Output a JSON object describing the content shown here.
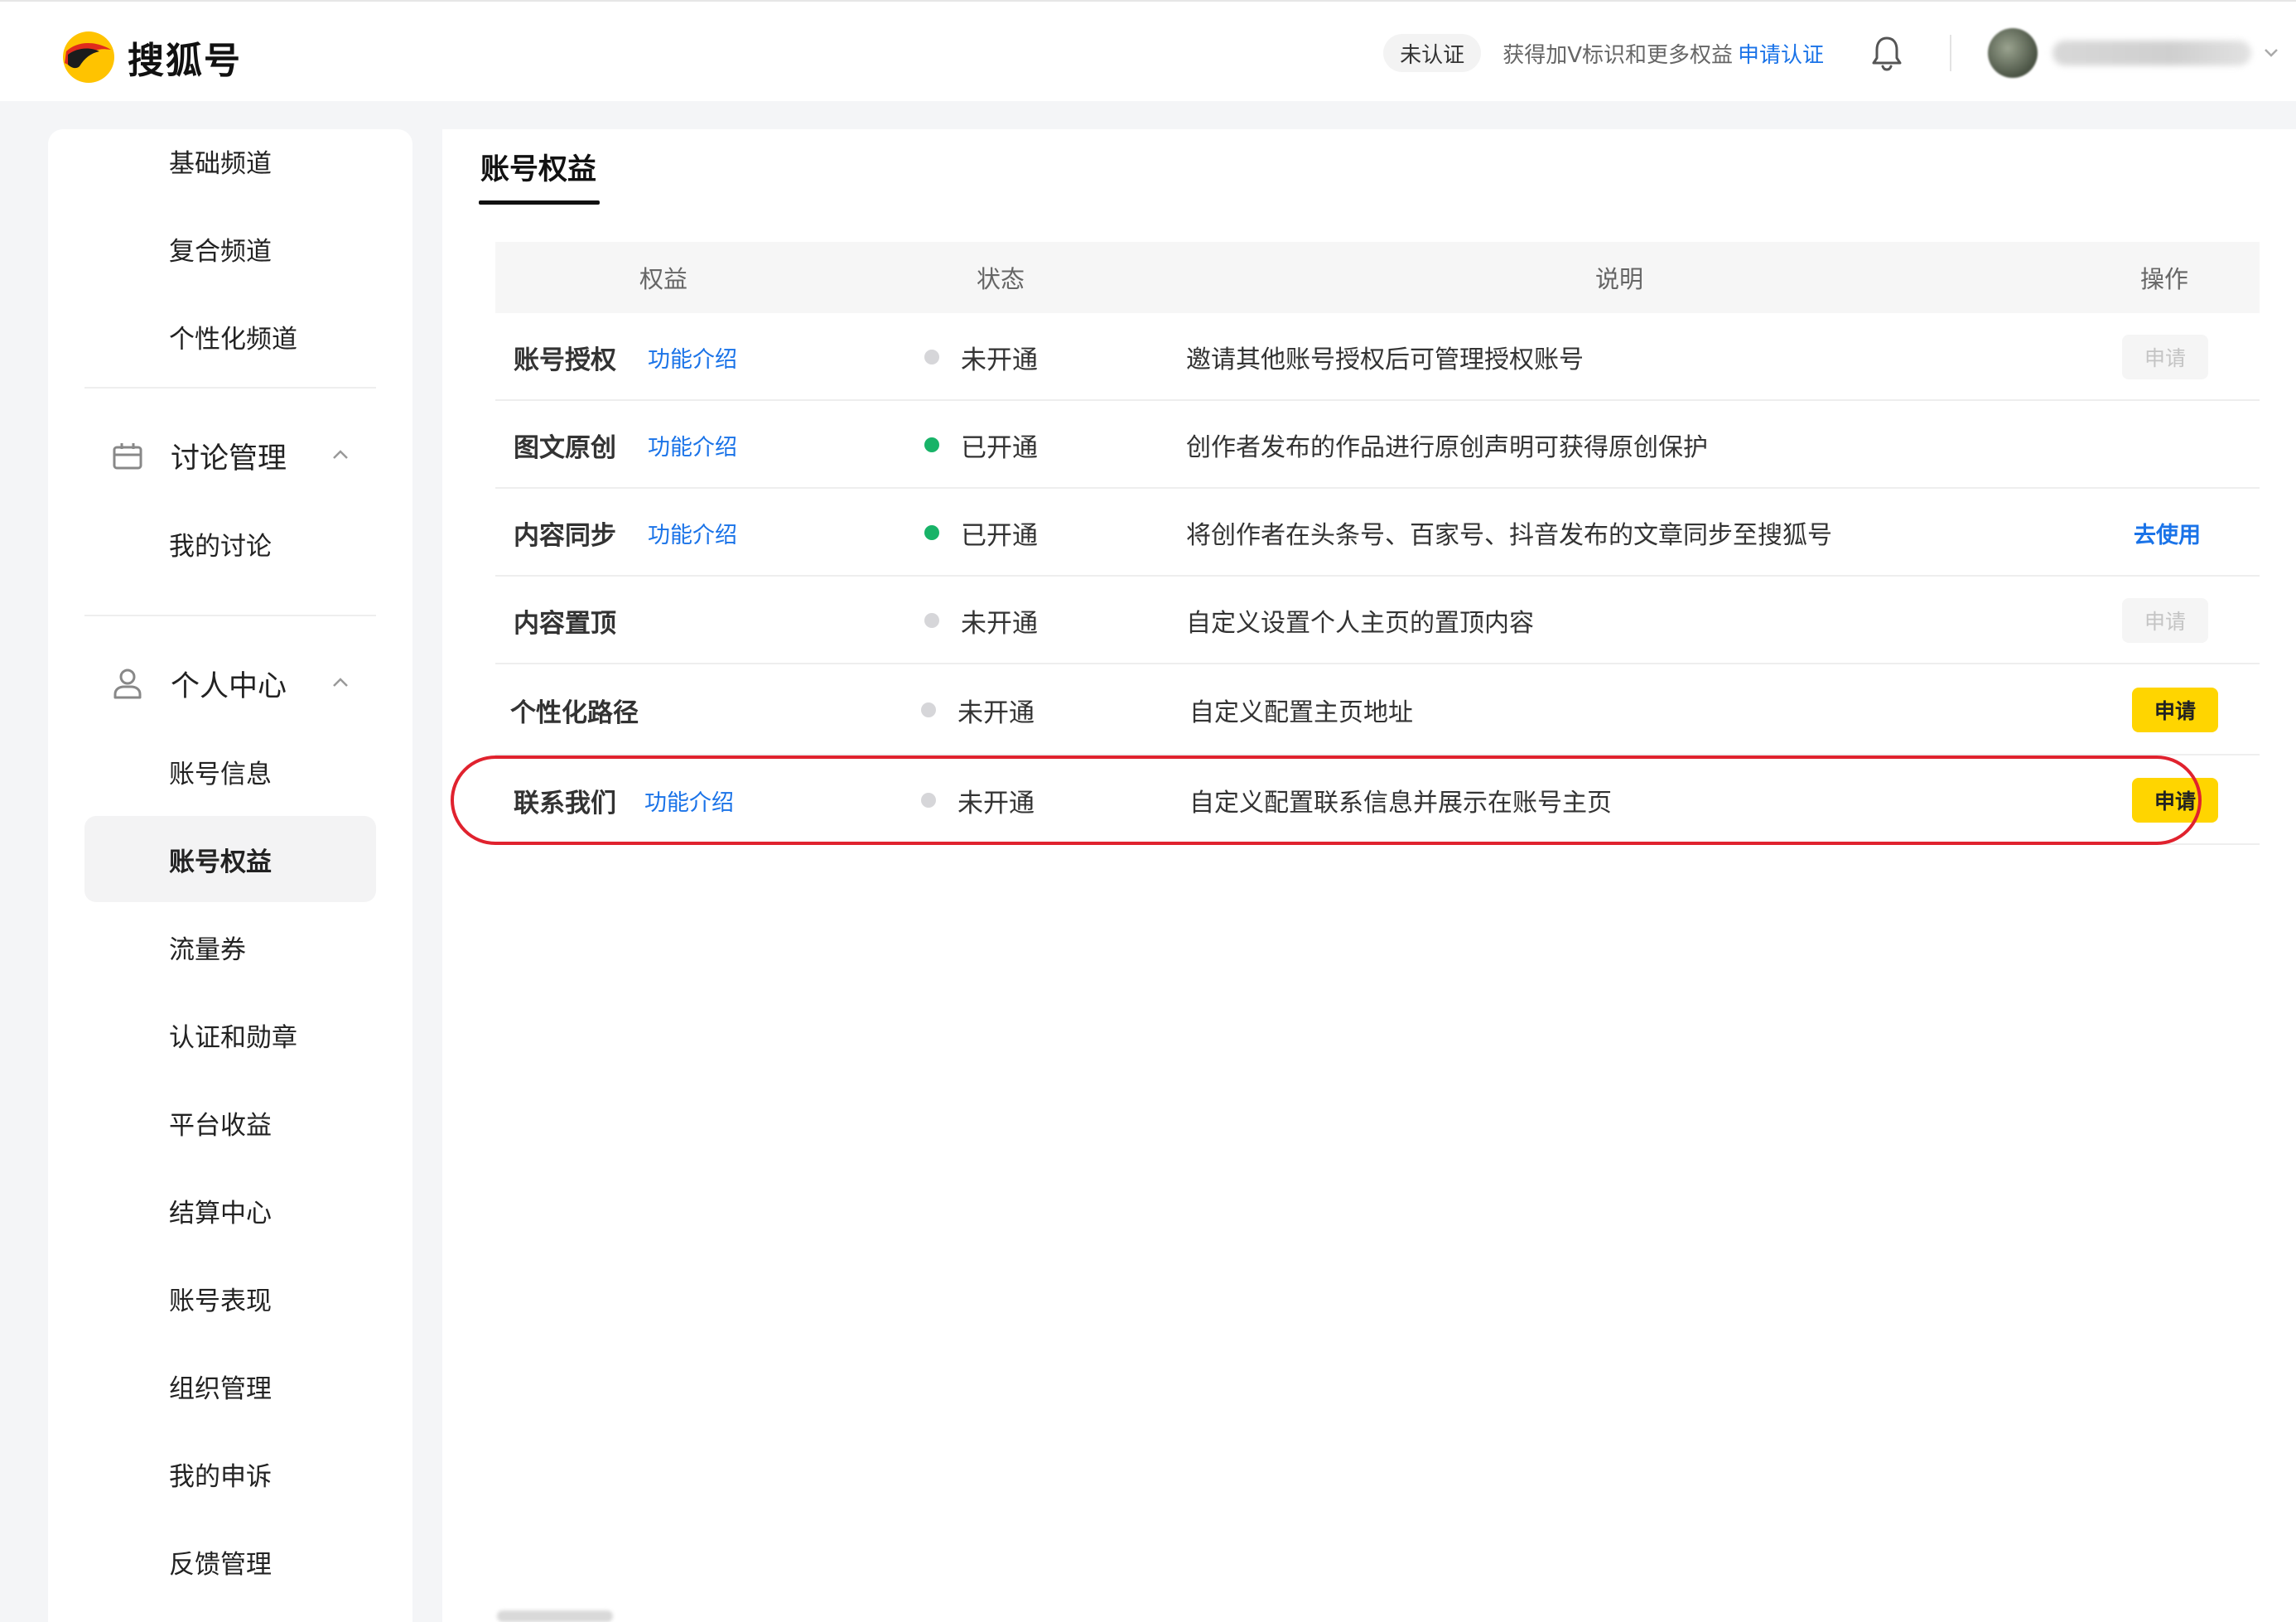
{
  "header": {
    "brand": "搜狐号",
    "cert_status": "未认证",
    "cert_hint": "获得加V标识和更多权益",
    "cert_link": "申请认证",
    "icons": {
      "bell": "bell-icon",
      "avatar": "user-avatar"
    }
  },
  "sidebar": {
    "top_items": [
      "基础频道",
      "复合频道",
      "个性化频道"
    ],
    "groups": [
      {
        "label": "讨论管理",
        "icon": "calendar-icon",
        "items": [
          "我的讨论"
        ]
      },
      {
        "label": "个人中心",
        "icon": "person-icon",
        "items": [
          "账号信息",
          "账号权益",
          "流量券",
          "认证和勋章",
          "平台收益",
          "结算中心",
          "账号表现",
          "组织管理",
          "我的申诉",
          "反馈管理"
        ]
      }
    ],
    "active_item": "账号权益"
  },
  "main": {
    "tab": "账号权益",
    "columns": [
      "权益",
      "状态",
      "说明",
      "操作"
    ],
    "rows": [
      {
        "name": "账号授权",
        "link": "功能介绍",
        "status": "未开通",
        "on": false,
        "desc": "邀请其他账号授权后可管理授权账号",
        "action": "申请",
        "action_type": "disabled"
      },
      {
        "name": "图文原创",
        "link": "功能介绍",
        "status": "已开通",
        "on": true,
        "desc": "创作者发布的作品进行原创声明可获得原创保护",
        "action": "",
        "action_type": "none"
      },
      {
        "name": "内容同步",
        "link": "功能介绍",
        "status": "已开通",
        "on": true,
        "desc": "将创作者在头条号、百家号、抖音发布的文章同步至搜狐号",
        "action": "去使用",
        "action_type": "link"
      },
      {
        "name": "内容置顶",
        "link": "",
        "status": "未开通",
        "on": false,
        "desc": "自定义设置个人主页的置顶内容",
        "action": "申请",
        "action_type": "disabled"
      },
      {
        "name": "个性化路径",
        "link": "",
        "status": "未开通",
        "on": false,
        "desc": "自定义配置主页地址",
        "action": "申请",
        "action_type": "primary"
      },
      {
        "name": "联系我们",
        "link": "功能介绍",
        "status": "未开通",
        "on": false,
        "desc": "自定义配置联系信息并展示在账号主页",
        "action": "申请",
        "action_type": "primary"
      }
    ]
  },
  "colors": {
    "accent_blue": "#1a73e8",
    "primary_yellow": "#ffd500",
    "status_on": "#18b368",
    "status_off": "#d6d6d9",
    "highlight_red": "#e0222e"
  }
}
